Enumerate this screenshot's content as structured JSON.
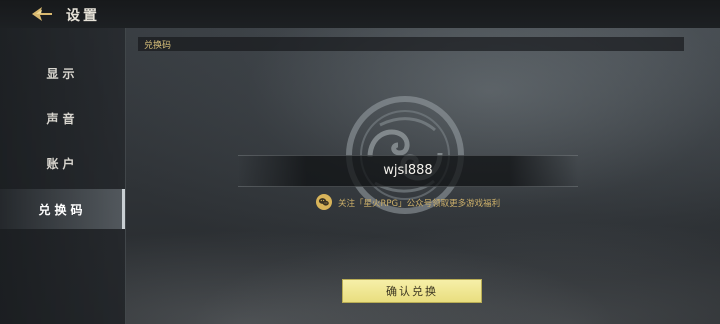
{
  "header": {
    "title": "设置",
    "back_icon": "back-arrow-icon"
  },
  "sidebar": {
    "items": [
      {
        "label": "显示",
        "active": false
      },
      {
        "label": "声音",
        "active": false
      },
      {
        "label": "账户",
        "active": false
      },
      {
        "label": "兑换码",
        "active": true
      }
    ]
  },
  "main": {
    "section_title": "兑换码",
    "code_input": {
      "value": "wjsl888"
    },
    "hint_text": "关注「星火RPG」公众号领取更多游戏福利",
    "hint_icon": "wechat-icon",
    "confirm_label": "确认兑换"
  },
  "colors": {
    "accent": "#d8c07a",
    "button_bg": "#f0e796",
    "active_tab": "#7a8086"
  }
}
